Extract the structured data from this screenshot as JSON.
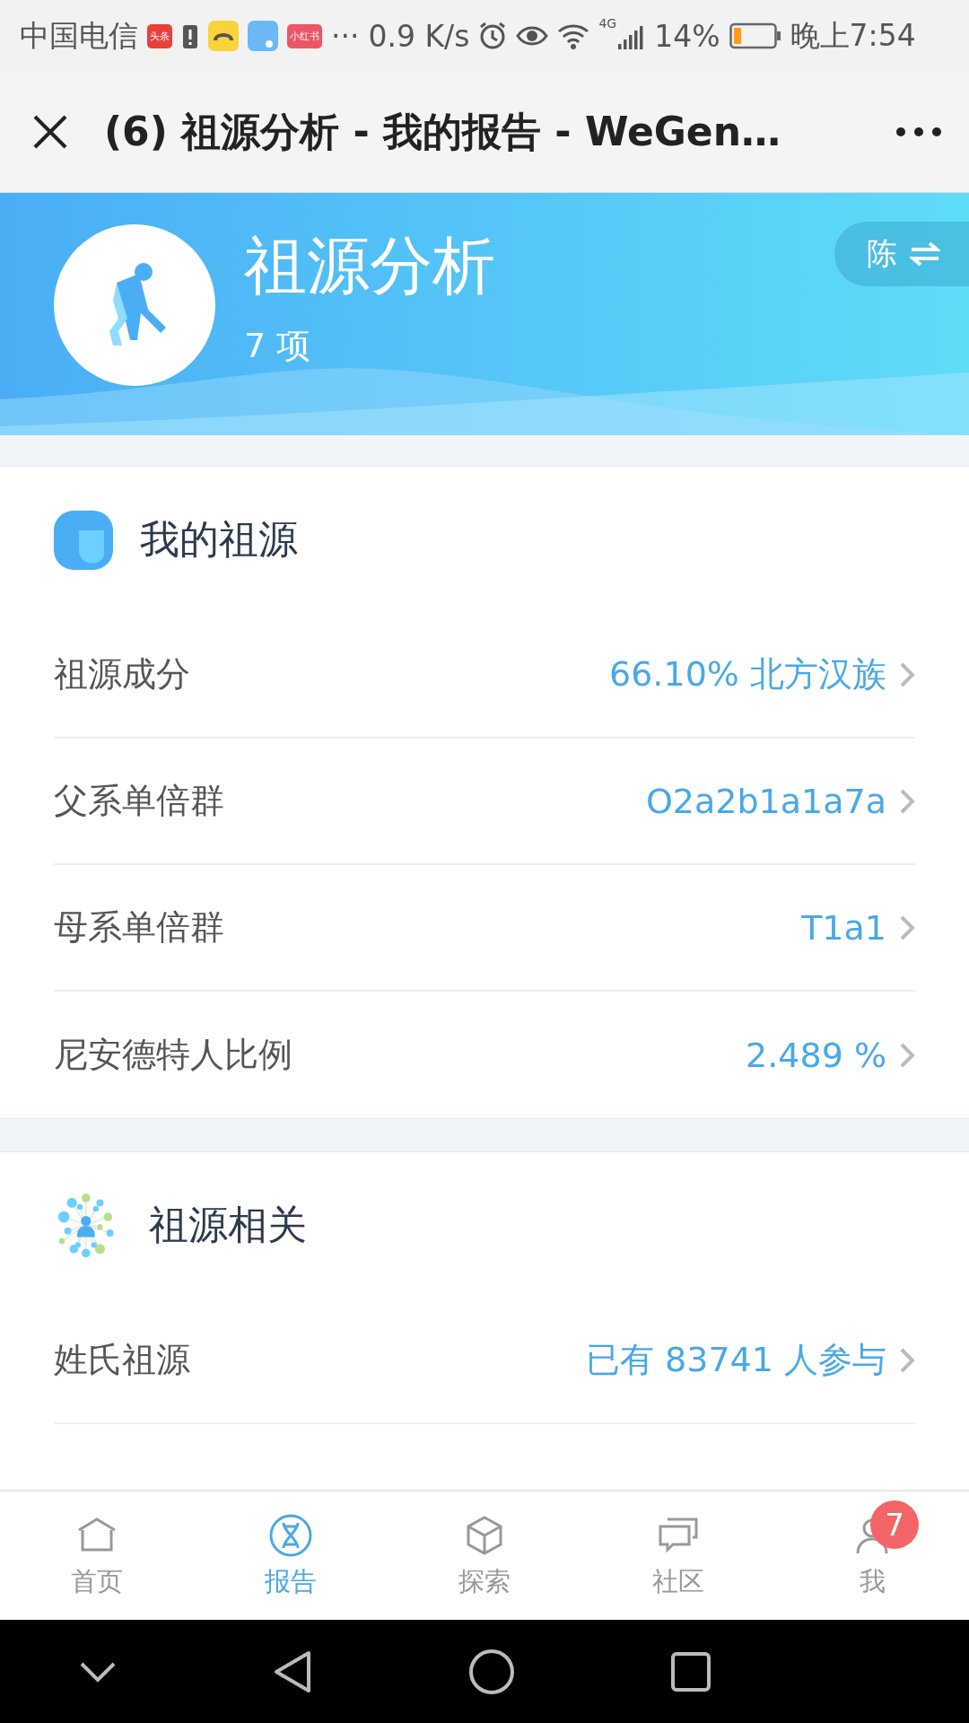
{
  "status_bar": {
    "carrier": "中国电信",
    "app_badges": [
      "头条",
      "小红书"
    ],
    "more": "···",
    "speed": "0.9 K/s",
    "network": "4G",
    "battery": "14%",
    "time": "晚上7:54"
  },
  "title_bar": {
    "title": "(6) 祖源分析 - 我的报告 - WeGen…"
  },
  "header": {
    "title": "祖源分析",
    "count": "7 项",
    "profile": "陈"
  },
  "sections": [
    {
      "title": "我的祖源",
      "kind": "face",
      "rows": [
        {
          "label": "祖源成分",
          "value": "66.10% 北方汉族"
        },
        {
          "label": "父系单倍群",
          "value": "O2a2b1a1a7a"
        },
        {
          "label": "母系单倍群",
          "value": "T1a1"
        },
        {
          "label": "尼安德特人比例",
          "value": "2.489 %"
        }
      ]
    },
    {
      "title": "祖源相关",
      "kind": "network",
      "rows": [
        {
          "label": "姓氏祖源",
          "value": "已有 83741 人参与"
        }
      ]
    }
  ],
  "tabs": [
    {
      "label": "首页",
      "kind": "home",
      "selected": false
    },
    {
      "label": "报告",
      "kind": "dna",
      "selected": true
    },
    {
      "label": "探索",
      "kind": "cube",
      "selected": false
    },
    {
      "label": "社区",
      "kind": "chat",
      "selected": false
    },
    {
      "label": "我",
      "kind": "user",
      "selected": false,
      "badge": "7"
    }
  ]
}
